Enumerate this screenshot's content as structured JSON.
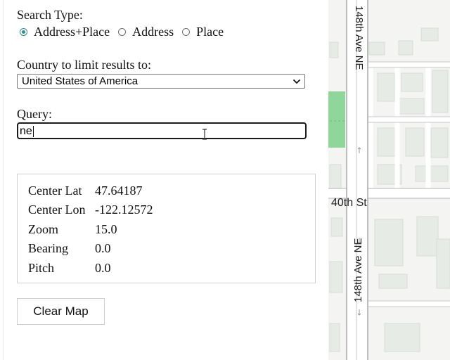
{
  "search_type": {
    "label": "Search Type:",
    "options": [
      {
        "label": "Address+Place",
        "checked": true
      },
      {
        "label": "Address",
        "checked": false
      },
      {
        "label": "Place",
        "checked": false
      }
    ]
  },
  "country": {
    "label": "Country to limit results to:",
    "selected": "United States of America"
  },
  "query": {
    "label": "Query:",
    "value": "ne"
  },
  "info": {
    "rows": [
      {
        "key": "Center Lat",
        "value": "47.64187"
      },
      {
        "key": "Center Lon",
        "value": "-122.12572"
      },
      {
        "key": "Zoom",
        "value": "15.0"
      },
      {
        "key": "Bearing",
        "value": "0.0"
      },
      {
        "key": "Pitch",
        "value": "0.0"
      }
    ]
  },
  "clear_button": {
    "label": "Clear Map"
  },
  "map": {
    "labels": {
      "street_148_top": "148th Ave NE",
      "street_40th": "40th St",
      "street_148_bottom": "148th Ave NE"
    },
    "colors": {
      "background": "#f4f4f3",
      "building": "#e7ebe6",
      "park": "#8fd69a",
      "road": "#ffffff",
      "road_edge": "#b8b8b8",
      "major_road": "#9e9e9e"
    }
  }
}
